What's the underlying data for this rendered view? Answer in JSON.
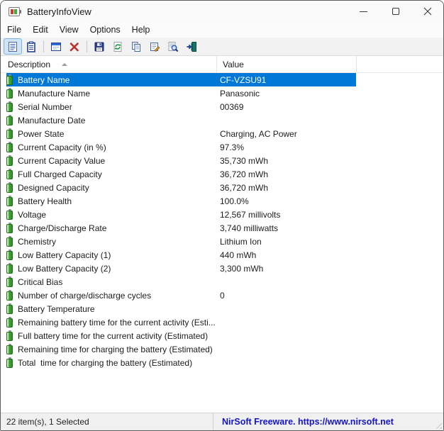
{
  "window": {
    "title": "BatteryInfoView"
  },
  "menu": {
    "items": [
      "File",
      "Edit",
      "View",
      "Options",
      "Help"
    ]
  },
  "toolbar": {
    "buttons": [
      {
        "name": "battery-information-view",
        "icon": "report-icon",
        "active": true
      },
      {
        "name": "battery-log-view",
        "icon": "clipboard-icon",
        "active": false
      },
      {
        "name": "options-window",
        "icon": "window-icon",
        "active": false
      },
      {
        "name": "delete",
        "icon": "red-x-icon",
        "active": false
      },
      {
        "name": "save-report",
        "icon": "floppy-disk-icon",
        "active": false
      },
      {
        "name": "refresh",
        "icon": "refresh-icon",
        "active": false
      },
      {
        "name": "copy-selected",
        "icon": "copy-icon",
        "active": false
      },
      {
        "name": "properties",
        "icon": "properties-icon",
        "active": false
      },
      {
        "name": "find",
        "icon": "find-icon",
        "active": false
      },
      {
        "name": "exit",
        "icon": "exit-icon",
        "active": false
      }
    ]
  },
  "list": {
    "columns": [
      {
        "label": "Description",
        "sorted": "asc"
      },
      {
        "label": "Value",
        "sorted": ""
      }
    ],
    "rows": [
      {
        "description": "Battery Name",
        "value": "CF-VZSU91",
        "selected": true
      },
      {
        "description": "Manufacture Name",
        "value": "Panasonic",
        "selected": false
      },
      {
        "description": "Serial Number",
        "value": "00369",
        "selected": false
      },
      {
        "description": "Manufacture Date",
        "value": "",
        "selected": false
      },
      {
        "description": "Power State",
        "value": "Charging, AC Power",
        "selected": false
      },
      {
        "description": "Current Capacity (in %)",
        "value": "97.3%",
        "selected": false
      },
      {
        "description": "Current Capacity Value",
        "value": "35,730 mWh",
        "selected": false
      },
      {
        "description": "Full Charged Capacity",
        "value": "36,720 mWh",
        "selected": false
      },
      {
        "description": "Designed Capacity",
        "value": "36,720 mWh",
        "selected": false
      },
      {
        "description": "Battery Health",
        "value": "100.0%",
        "selected": false
      },
      {
        "description": "Voltage",
        "value": "12,567 millivolts",
        "selected": false
      },
      {
        "description": "Charge/Discharge Rate",
        "value": "3,740 milliwatts",
        "selected": false
      },
      {
        "description": "Chemistry",
        "value": "Lithium Ion",
        "selected": false
      },
      {
        "description": "Low Battery Capacity (1)",
        "value": "440 mWh",
        "selected": false
      },
      {
        "description": "Low Battery Capacity (2)",
        "value": "3,300 mWh",
        "selected": false
      },
      {
        "description": "Critical Bias",
        "value": "",
        "selected": false
      },
      {
        "description": "Number of charge/discharge cycles",
        "value": "0",
        "selected": false
      },
      {
        "description": "Battery Temperature",
        "value": "",
        "selected": false
      },
      {
        "description": "Remaining battery time for the current activity (Esti...",
        "value": "",
        "selected": false
      },
      {
        "description": "Full battery time for the current activity (Estimated)",
        "value": "",
        "selected": false
      },
      {
        "description": "Remaining time for charging the battery (Estimated)",
        "value": "",
        "selected": false
      },
      {
        "description": "Total  time for charging the battery (Estimated)",
        "value": "",
        "selected": false
      }
    ]
  },
  "statusbar": {
    "items_text": "22 item(s), 1 Selected",
    "link_text": "NirSoft Freeware. https://www.nirsoft.net"
  },
  "colors": {
    "selection": "#0078d7",
    "selection_text": "#ffffff",
    "link_blue": "#1414c8",
    "battery_green": "#3ea93c",
    "delete_red": "#b7312c"
  }
}
